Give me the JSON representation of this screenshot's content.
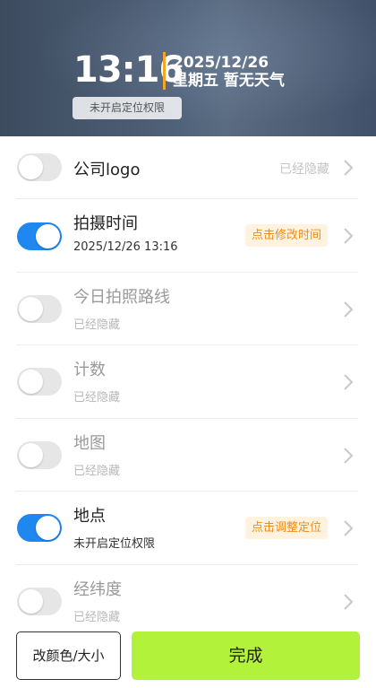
{
  "preview": {
    "time": "13:16",
    "date": "2025/12/26",
    "weekday_weather": "星期五  暂无天气",
    "location_badge": "未开启定位权限",
    "accent_color": "#f5a623"
  },
  "items": [
    {
      "title": "公司logo",
      "subtitle": "",
      "enabled": false,
      "right_text": "已经隐藏",
      "action": ""
    },
    {
      "title": "拍摄时间",
      "subtitle": "2025/12/26 13:16",
      "enabled": true,
      "right_text": "",
      "action": "点击修改时间"
    },
    {
      "title": "今日拍照路线",
      "subtitle": "已经隐藏",
      "enabled": false,
      "right_text": "",
      "action": ""
    },
    {
      "title": "计数",
      "subtitle": "已经隐藏",
      "enabled": false,
      "right_text": "",
      "action": ""
    },
    {
      "title": "地图",
      "subtitle": "已经隐藏",
      "enabled": false,
      "right_text": "",
      "action": ""
    },
    {
      "title": "地点",
      "subtitle": "未开启定位权限",
      "enabled": true,
      "right_text": "",
      "action": "点击调整定位"
    },
    {
      "title": "经纬度",
      "subtitle": "已经隐藏",
      "enabled": false,
      "right_text": "",
      "action": ""
    }
  ],
  "footer": {
    "style_button": "改颜色/大小",
    "done_button": "完成"
  },
  "colors": {
    "toggle_on": "#1e88f0",
    "toggle_off": "#e6e6e6",
    "done_button": "#b3f23b",
    "action_tag_text": "#f08c1a",
    "action_tag_bg": "#fff3e0"
  }
}
